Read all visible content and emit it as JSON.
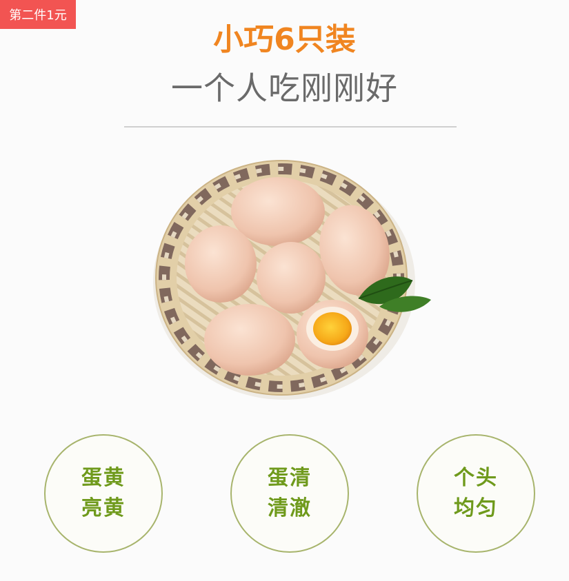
{
  "promo": {
    "badge_text": "第二件1元"
  },
  "headline": {
    "title": "小巧6只装",
    "subtitle": "一个人吃刚刚好"
  },
  "features": [
    {
      "line1": "蛋黄",
      "line2": "亮黄"
    },
    {
      "line1": "蛋清",
      "line2": "清澈"
    },
    {
      "line1": "个头",
      "line2": "均匀"
    }
  ],
  "colors": {
    "badge": "#f25452",
    "title": "#f08520",
    "subtitle": "#6a6a6a",
    "feature_text": "#6f9a1c",
    "feature_border": "#a7b46c"
  }
}
